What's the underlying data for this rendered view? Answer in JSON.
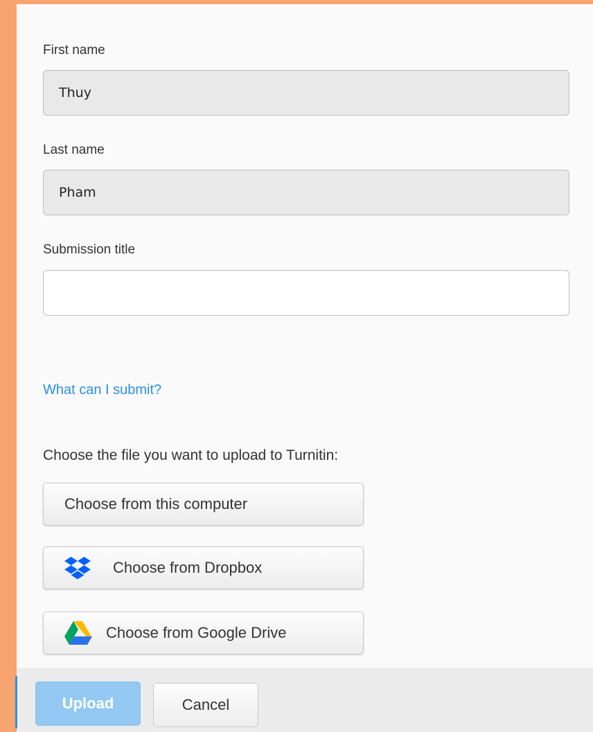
{
  "form": {
    "first_name_label": "First name",
    "first_name_value": "Thuy",
    "last_name_label": "Last name",
    "last_name_value": "Pham",
    "submission_title_label": "Submission title",
    "submission_title_value": ""
  },
  "help_link": "What can I submit?",
  "upload": {
    "instruction": "Choose the file you want to upload to Turnitin:",
    "computer_label": "Choose from this computer",
    "dropbox_label": "Choose from Dropbox",
    "drive_label": "Choose from Google Drive",
    "dropbox_icon": "dropbox-icon",
    "drive_icon": "google-drive-icon"
  },
  "footer": {
    "upload_label": "Upload",
    "cancel_label": "Cancel",
    "upload_enabled": false
  },
  "colors": {
    "background_accent": "#f7a46f",
    "link": "#2e8fe6",
    "upload_button": "#93c8f2",
    "dropbox": "#0061fe"
  }
}
